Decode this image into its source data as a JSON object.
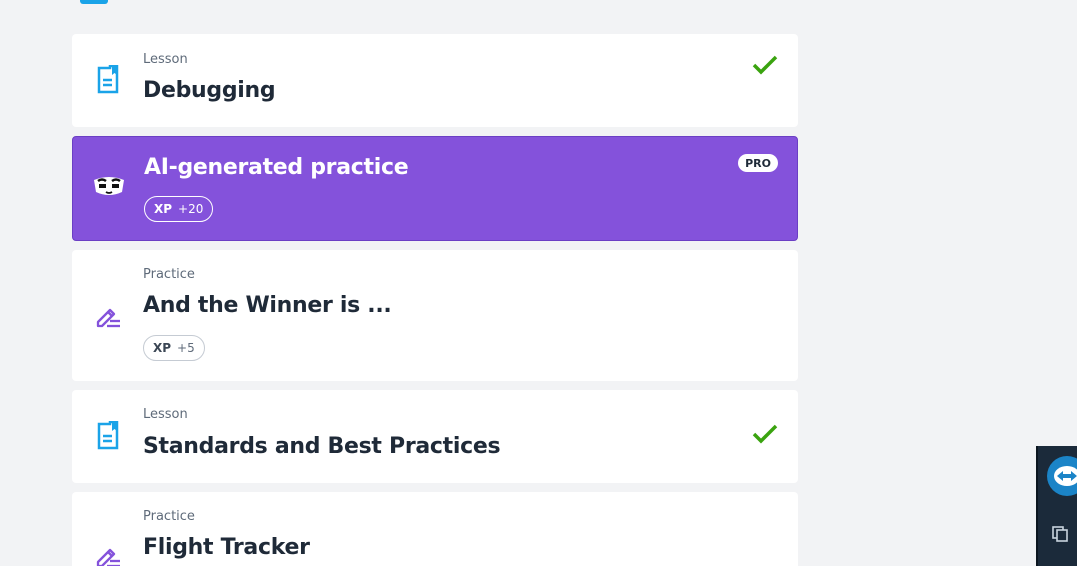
{
  "cards": [
    {
      "type": "Lesson",
      "title": "Debugging",
      "completed": true,
      "icon": "lesson-icon"
    },
    {
      "type": "",
      "title": "AI-generated practice",
      "xp_label": "XP",
      "xp_value": "+20",
      "badge": "PRO",
      "icon": "ai-robot-icon",
      "accent": "#8452db"
    },
    {
      "type": "Practice",
      "title": "And the Winner is ...",
      "xp_label": "XP",
      "xp_value": "+5",
      "icon": "practice-pencil-icon"
    },
    {
      "type": "Lesson",
      "title": "Standards and Best Practices",
      "completed": true,
      "icon": "lesson-icon"
    },
    {
      "type": "Practice",
      "title": "Flight Tracker",
      "icon": "practice-pencil-icon"
    }
  ],
  "colors": {
    "lesson_icon": "#1aa3e8",
    "practice_icon": "#8452db",
    "check": "#3aa30f",
    "text_dark": "#1f2a38"
  },
  "side_widget": {
    "icons": [
      "remote-control-icon",
      "copy-icon"
    ]
  }
}
